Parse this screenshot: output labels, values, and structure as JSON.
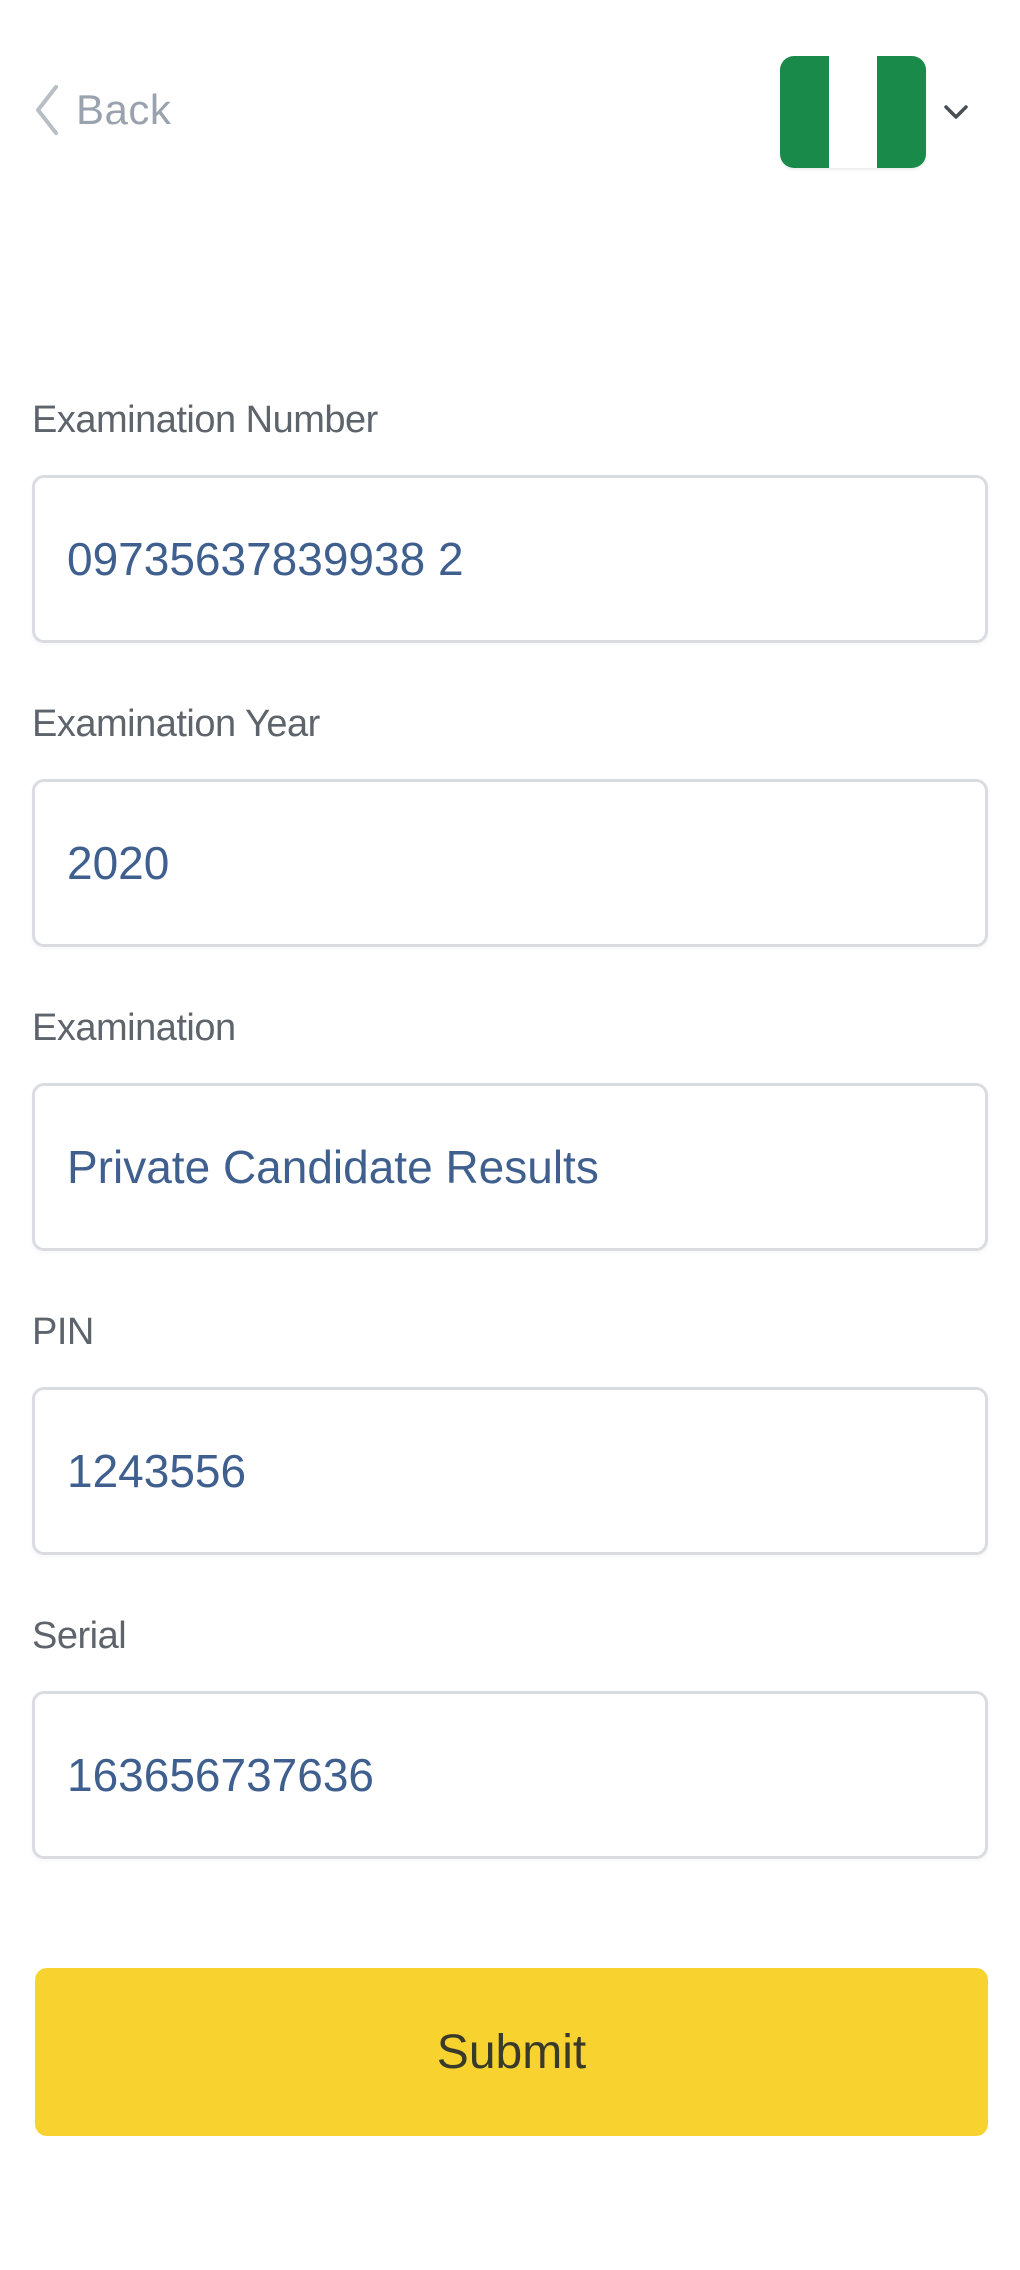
{
  "header": {
    "back_label": "Back",
    "back_icon": "chevron-left-icon",
    "language_flag": {
      "name": "nigeria-flag-icon",
      "colors": [
        "#1a8a4a",
        "#ffffff",
        "#1a8a4a"
      ]
    },
    "dropdown_icon": "chevron-down-icon"
  },
  "form": {
    "fields": [
      {
        "label": "Examination Number",
        "value": "09735637839938 2"
      },
      {
        "label": "Examination Year",
        "value": "2020"
      },
      {
        "label": "Examination",
        "value": "Private Candidate Results"
      },
      {
        "label": "PIN",
        "value": "1243556"
      },
      {
        "label": "Serial",
        "value": "163656737636"
      }
    ],
    "submit_label": "Submit"
  },
  "colors": {
    "accent": "#f8d22f",
    "input_text": "#3f5f8f",
    "label_text": "#5e646b",
    "border": "#d9dde2",
    "flag_green": "#1a8a4a"
  }
}
